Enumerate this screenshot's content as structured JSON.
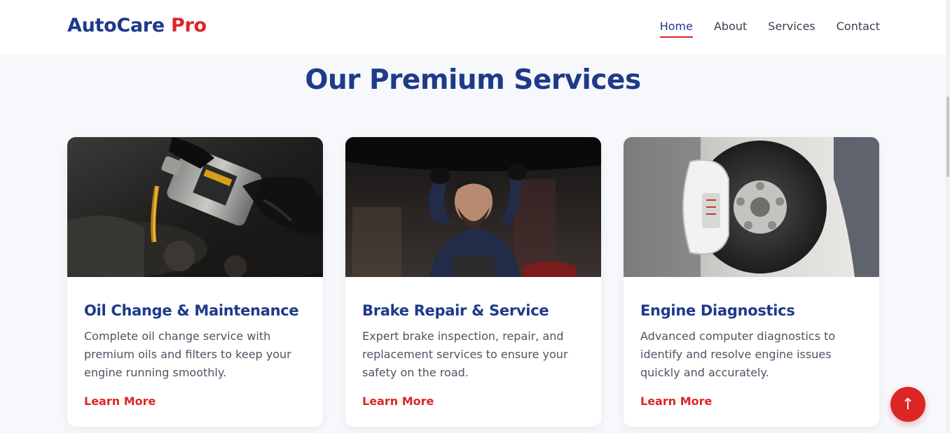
{
  "brand": {
    "name": "AutoCare",
    "accent": "Pro"
  },
  "nav": {
    "items": [
      {
        "label": "Home",
        "active": true
      },
      {
        "label": "About",
        "active": false
      },
      {
        "label": "Services",
        "active": false
      },
      {
        "label": "Contact",
        "active": false
      }
    ]
  },
  "services": {
    "title": "Our Premium Services",
    "cards": [
      {
        "title": "Oil Change & Maintenance",
        "description": "Complete oil change service with premium oils and filters to keep your engine running smoothly.",
        "link": "Learn More",
        "image": "oil-pour-engine-photo"
      },
      {
        "title": "Brake Repair & Service",
        "description": "Expert brake inspection, repair, and replacement services to ensure your safety on the road.",
        "link": "Learn More",
        "image": "mechanic-under-car-photo"
      },
      {
        "title": "Engine Diagnostics",
        "description": "Advanced computer diagnostics to identify and resolve engine issues quickly and accurately.",
        "link": "Learn More",
        "image": "brake-disc-caliper-photo"
      }
    ]
  },
  "back_to_top": {
    "icon": "arrow-up-icon",
    "glyph": "↑"
  },
  "colors": {
    "primary": "#1e3a8a",
    "accent": "#dc2626",
    "background": "#f6f8fb"
  }
}
